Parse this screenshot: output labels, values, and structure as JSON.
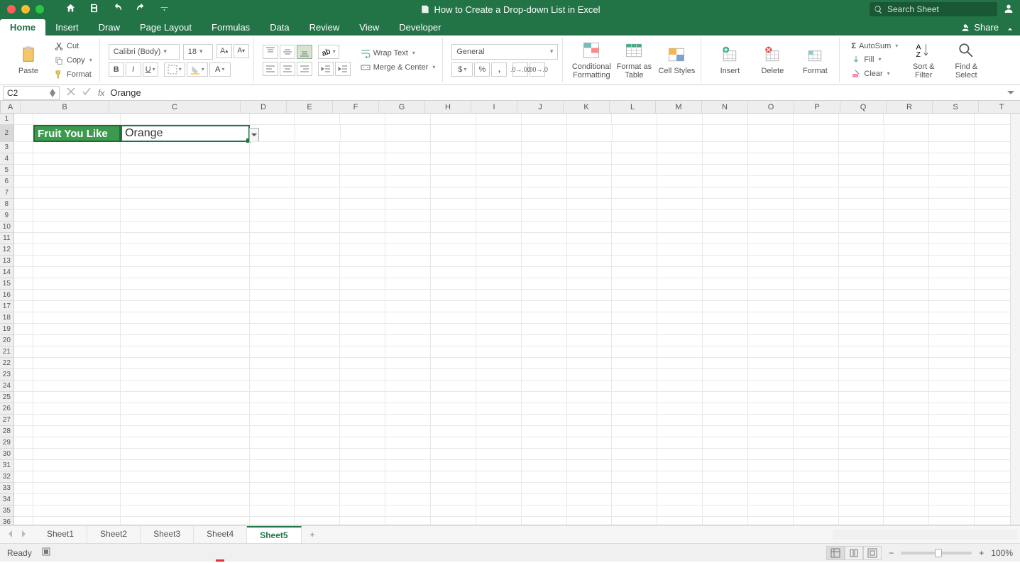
{
  "title": "How to Create a Drop-down List in Excel",
  "search_placeholder": "Search Sheet",
  "share_label": "Share",
  "tabs": [
    "Home",
    "Insert",
    "Draw",
    "Page Layout",
    "Formulas",
    "Data",
    "Review",
    "View",
    "Developer"
  ],
  "active_tab": "Home",
  "clipboard": {
    "paste": "Paste",
    "cut": "Cut",
    "copy": "Copy",
    "format": "Format"
  },
  "font": {
    "name": "Calibri (Body)",
    "size": "18"
  },
  "alignment": {
    "wrap": "Wrap Text",
    "merge": "Merge & Center"
  },
  "number_format": "General",
  "styles": {
    "cond": "Conditional Formatting",
    "table": "Format as Table",
    "cell": "Cell Styles"
  },
  "cells": {
    "insert": "Insert",
    "delete": "Delete",
    "format": "Format"
  },
  "editing": {
    "autosum": "AutoSum",
    "fill": "Fill",
    "clear": "Clear",
    "sort": "Sort & Filter",
    "find": "Find & Select"
  },
  "namebox": "C2",
  "formula_value": "Orange",
  "cols": {
    "list": [
      "A",
      "B",
      "C",
      "D",
      "E",
      "F",
      "G",
      "H",
      "I",
      "J",
      "K",
      "L",
      "M",
      "N",
      "O",
      "P",
      "Q",
      "R",
      "S",
      "T"
    ],
    "widths": {
      "A": 28,
      "B": 125,
      "C": 185,
      "D": 65,
      "E": 65,
      "F": 65,
      "G": 65,
      "H": 65,
      "I": 65,
      "J": 65,
      "K": 65,
      "L": 65,
      "M": 65,
      "N": 65,
      "O": 65,
      "P": 65,
      "Q": 65,
      "R": 65,
      "S": 65,
      "T": 65
    }
  },
  "row_count": 36,
  "cells_data": {
    "B2": "Fruit You Like",
    "C2": "Orange"
  },
  "sheets": [
    "Sheet1",
    "Sheet2",
    "Sheet3",
    "Sheet4",
    "Sheet5"
  ],
  "active_sheet": "Sheet5",
  "status": "Ready",
  "zoom": "100%"
}
